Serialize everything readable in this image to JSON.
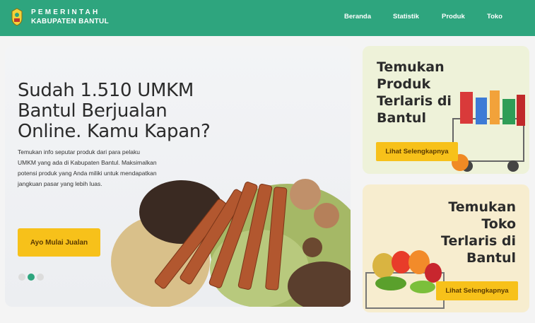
{
  "header": {
    "brand_line1": "PEMERINTAH",
    "brand_line2": "KABUPATEN BANTUL",
    "nav": [
      "Beranda",
      "Statistik",
      "Produk",
      "Toko"
    ]
  },
  "hero": {
    "title": "Sudah 1.510 UMKM Bantul Berjualan Online. Kamu Kapan?",
    "description": "Temukan info seputar produk dari para pelaku UMKM yang ada di Kabupaten Bantul. Maksimalkan potensi produk yang Anda miliki untuk mendapatkan jangkuan pasar yang lebih luas.",
    "cta": "Ayo Mulai Jualan",
    "carousel_dots": 3,
    "active_dot": 2
  },
  "cards": [
    {
      "title": "Temukan Produk Terlaris di Bantul",
      "button": "Lihat Selengkapnya"
    },
    {
      "title": "Temukan Toko Terlaris di Bantul",
      "button": "Lihat Selengkapnya"
    }
  ],
  "colors": {
    "primary": "#2ea57e",
    "accent": "#f7c11a"
  }
}
